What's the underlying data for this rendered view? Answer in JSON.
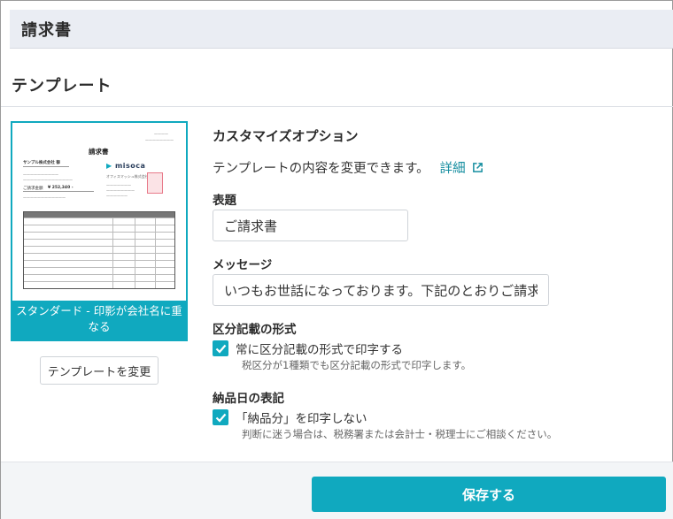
{
  "header": {
    "title": "請求書"
  },
  "template_section": {
    "title": "テンプレート"
  },
  "template_card": {
    "caption": "スタンダード - 印影が会社名に重なる",
    "preview": {
      "doc_title": "請求書",
      "customer": "サンプル株式会社 御",
      "logo": "misoca",
      "total_label": "ご請求金額",
      "total_value": "¥ 252,340 -",
      "issuer": "オフィスマッシュ株式会社"
    },
    "change_button": "テンプレートを変更"
  },
  "options": {
    "heading": "カスタマイズオプション",
    "description": "テンプレートの内容を変更できます。",
    "details_link": "詳細",
    "title_field": {
      "label": "表題",
      "value": "ご請求書"
    },
    "message_field": {
      "label": "メッセージ",
      "value": "いつもお世話になっております。下記のとおりご請求申し上げます。"
    },
    "tax_format": {
      "label": "区分記載の形式",
      "checkbox_label": "常に区分記載の形式で印字する",
      "checked": true,
      "help": "税区分が1種類でも区分記載の形式で印字します。"
    },
    "delivery_date": {
      "label": "納品日の表記",
      "checkbox_label": "「納品分」を印字しない",
      "checked": true,
      "help": "判断に迷う場合は、税務署または会計士・税理士にご相談ください。"
    }
  },
  "footer": {
    "save_button": "保存する"
  },
  "colors": {
    "accent": "#10a9bf",
    "link": "#168ea0",
    "header_bg": "#eaedf3"
  }
}
